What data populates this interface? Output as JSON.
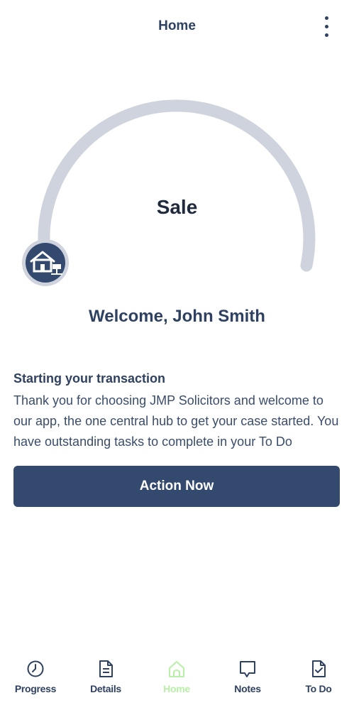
{
  "header": {
    "title": "Home",
    "menu_icon": "more-vertical-icon"
  },
  "progress": {
    "stage": "Sale",
    "fraction_complete": 0.0,
    "track_color": "#cfd3dd",
    "badge_icon": "house-for-sale-icon"
  },
  "welcome": {
    "text": "Welcome, John Smith"
  },
  "message": {
    "title": "Starting your transaction",
    "body": "Thank you for choosing JMP Solicitors and welcome to our app, the one central hub to get your case started. You have outstanding tasks to complete in your To Do"
  },
  "action_button": {
    "label": "Action Now",
    "color": "#334a6e"
  },
  "bottom_nav": {
    "active_color": "#b9f0a8",
    "items": [
      {
        "label": "Progress",
        "icon": "clock-icon"
      },
      {
        "label": "Details",
        "icon": "document-icon"
      },
      {
        "label": "Home",
        "icon": "home-icon"
      },
      {
        "label": "Notes",
        "icon": "speech-bubble-icon"
      },
      {
        "label": "To Do",
        "icon": "checklist-document-icon"
      }
    ]
  }
}
